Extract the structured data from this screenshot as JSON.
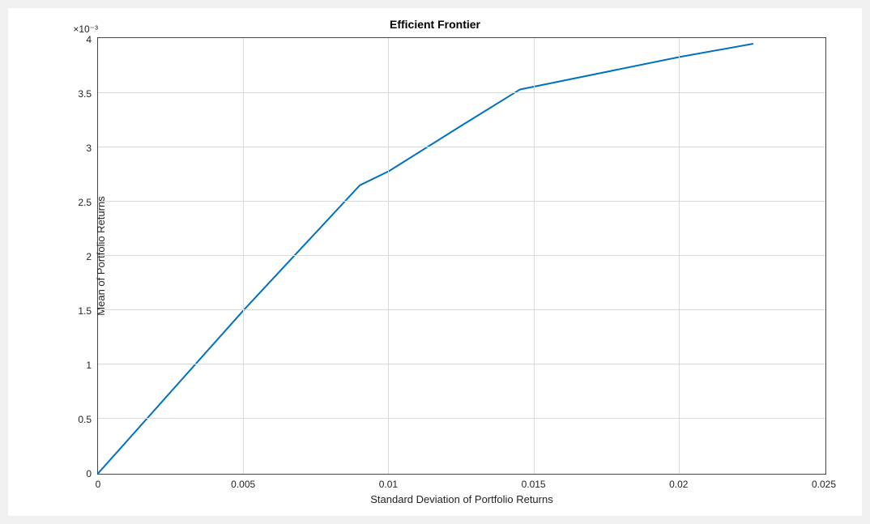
{
  "chart_data": {
    "type": "line",
    "title": "Efficient  Frontier",
    "xlabel": "Standard Deviation of Portfolio Returns",
    "ylabel": "Mean of Portfolio Returns",
    "y_exponent_label": "×10⁻³",
    "xlim": [
      0,
      0.025
    ],
    "ylim": [
      0,
      0.004
    ],
    "xticks": [
      0,
      0.005,
      0.01,
      0.015,
      0.02,
      0.025
    ],
    "yticks": [
      0,
      0.0005,
      0.001,
      0.0015,
      0.002,
      0.0025,
      0.003,
      0.0035,
      0.004
    ],
    "ytick_labels": [
      "0",
      "0.5",
      "1",
      "1.5",
      "2",
      "2.5",
      "3",
      "3.5",
      "4"
    ],
    "series": [
      {
        "name": "Efficient Frontier",
        "color": "#0072bd",
        "x": [
          0.0,
          0.005,
          0.009,
          0.01,
          0.0125,
          0.0145,
          0.02,
          0.0225
        ],
        "y": [
          0.0,
          0.0015,
          0.00265,
          0.00278,
          0.0032,
          0.00353,
          0.00383,
          0.00395
        ]
      }
    ],
    "grid": true
  }
}
